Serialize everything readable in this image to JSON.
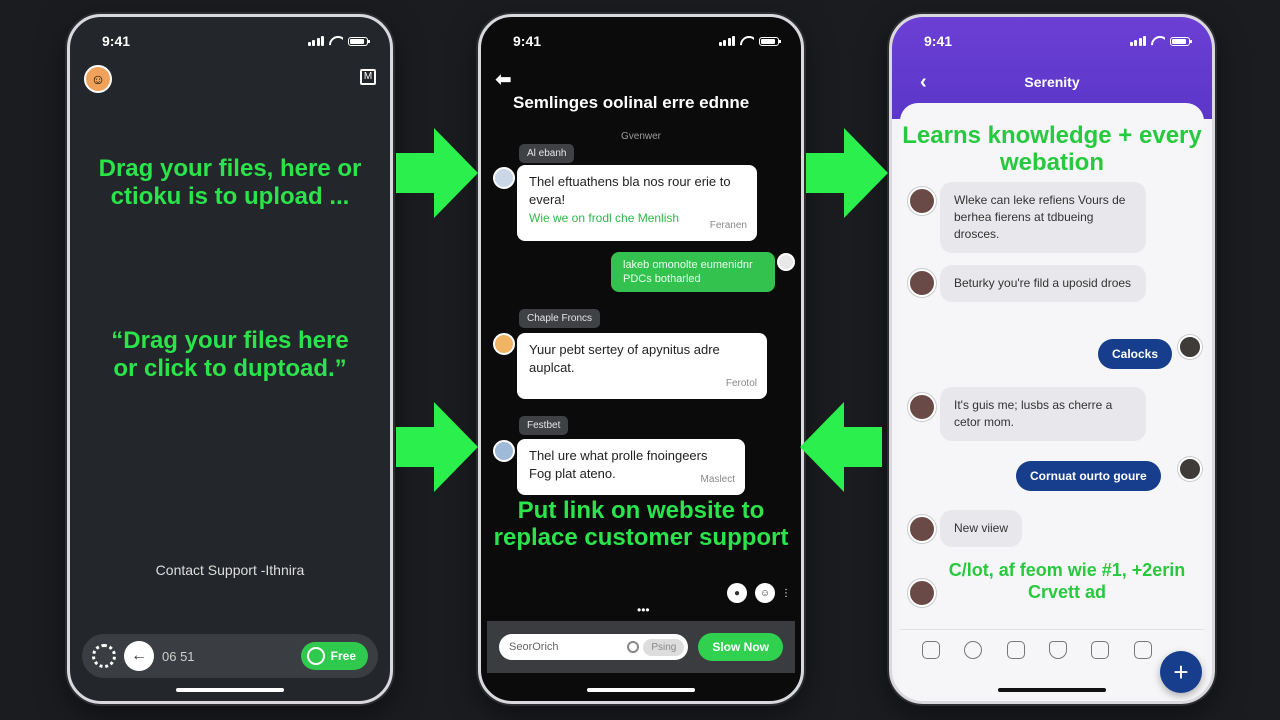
{
  "status_time": "9:41",
  "colors": {
    "accent_green": "#2be34b",
    "purple": "#6c3fd4",
    "navy": "#163e8c"
  },
  "phone1": {
    "headline_1": "Drag your files, here or ctioku is to upload ...",
    "headline_2": "“Drag your files here or click to duptoad.”",
    "contact": "Contact Support -Ithnira",
    "bottom_time": "06 51",
    "free_label": "Free"
  },
  "phone2": {
    "title": "Semlinges oolinal erre ednne",
    "subtitle": "Gvenwer",
    "tags": [
      "Al ebanh",
      "Chaple Froncs",
      "Festbet"
    ],
    "bubble1_line": "Thel eftuathens bla nos rour erie to evera!",
    "bubble1_green": "Wie we on frodl che Menlish",
    "bubble1_small": "Feranen",
    "green_bubble": "lakeb omonolte eumenidnr PDCs botharled",
    "bubble2": "Yuur pebt sertey of apynitus adre auplcat.",
    "bubble2_small": "Ferotol",
    "bubble3": "Thel ure what prolle fnoingeers Fog plat ateno.",
    "bubble3_small": "Maslect",
    "footer_text": "Put link on website to replace customer support",
    "search_placeholder": "SeorOrich",
    "search_pill": "Psing",
    "show_now": "Slow Now"
  },
  "phone3": {
    "title": "Serenity",
    "learn": "Learns knowledge + every webation",
    "msg1": "Wleke can leke refiens Vours de berhea fierens at tdbueing drosces.",
    "msg2": "Beturky you're fild a uposid droes",
    "out1": "Calocks",
    "msg3": "It's guis me; lusbs as cherre a cetor mom.",
    "out2": "Cornuat ourto goure",
    "msg4": "New viiew",
    "green2": "C/lot, af feom wie #1, +2erin Crvett ad"
  }
}
